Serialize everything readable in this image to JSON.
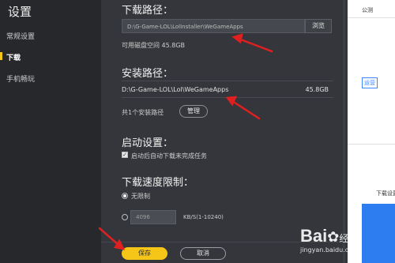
{
  "app": {
    "title": "设置"
  },
  "sidebar": {
    "items": [
      {
        "label": "常规设置"
      },
      {
        "label": "下载"
      },
      {
        "label": "手机畅玩"
      }
    ]
  },
  "download_path": {
    "title": "下载路径：",
    "value": "D:\\G-Game-LOL\\LolInstaller\\WeGameApps",
    "browse_label": "浏览",
    "free_space": "可用磁盘空间 45.8GB"
  },
  "install_path": {
    "title": "安装路径：",
    "path": "D:\\G-Game-LOL\\Lol\\WeGameApps",
    "size": "45.8GB",
    "count_text": "共1个安装路径",
    "manage_label": "管理"
  },
  "startup": {
    "title": "启动设置：",
    "auto_resume_label": "启动后自动下载未完成任务",
    "auto_resume_checked": true
  },
  "speed": {
    "title": "下载速度限制：",
    "unlimited_label": "无限制",
    "limit_value": "4096",
    "limit_unit": "KB/S(1-10240)"
  },
  "footer": {
    "save_label": "保存",
    "cancel_label": "取消"
  },
  "background_app": {
    "tab_text": "公测",
    "button_text": "运营",
    "row_text": "下载设置"
  },
  "watermark": {
    "brand": "Bai",
    "brand_suffix": "经验",
    "site": "jingyan.baidu.com"
  },
  "colors": {
    "accent": "#f5c517",
    "arrow": "#e02020",
    "window": "#2d2f34"
  }
}
